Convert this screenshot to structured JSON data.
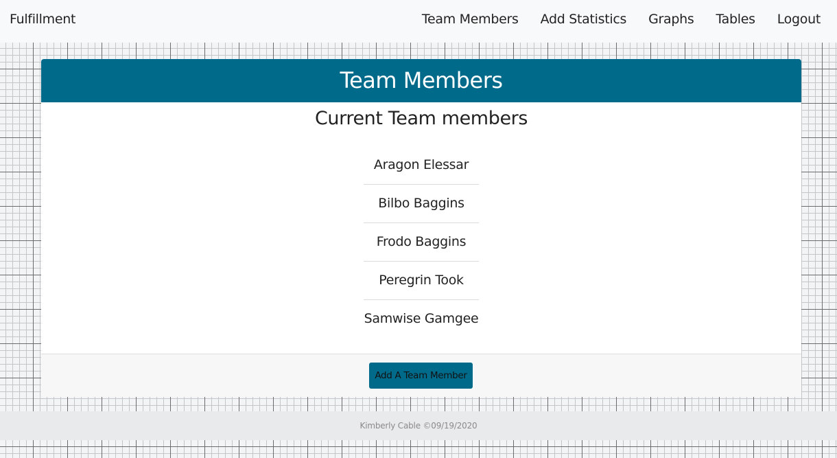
{
  "navbar": {
    "brand": "Fulfillment",
    "links": [
      {
        "label": "Team Members"
      },
      {
        "label": "Add Statistics"
      },
      {
        "label": "Graphs"
      },
      {
        "label": "Tables"
      },
      {
        "label": "Logout"
      }
    ]
  },
  "card": {
    "header": "Team Members",
    "subtitle": "Current Team members",
    "members": [
      "Aragon Elessar",
      "Bilbo Baggins",
      "Frodo Baggins",
      "Peregrin Took",
      "Samwise Gamgee"
    ],
    "add_button_label": "Add A Team Member"
  },
  "footer": {
    "text": "Kimberly Cable ©09/19/2020"
  },
  "colors": {
    "accent": "#006a8a",
    "navbar_bg": "#f8f9fa"
  }
}
